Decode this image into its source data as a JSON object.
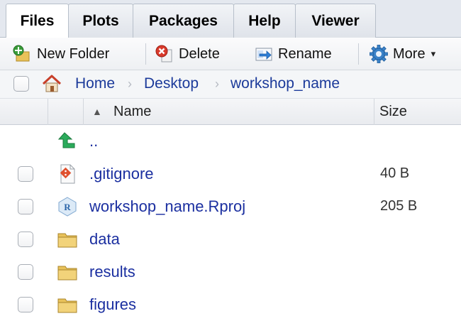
{
  "tabs": [
    {
      "label": "Files",
      "active": true
    },
    {
      "label": "Plots",
      "active": false
    },
    {
      "label": "Packages",
      "active": false
    },
    {
      "label": "Help",
      "active": false
    },
    {
      "label": "Viewer",
      "active": false
    }
  ],
  "toolbar": {
    "new_folder": {
      "label": "New Folder",
      "icon": "new-folder-icon"
    },
    "delete": {
      "label": "Delete",
      "icon": "delete-icon"
    },
    "rename": {
      "label": "Rename",
      "icon": "rename-icon"
    },
    "more": {
      "label": "More",
      "icon": "gear-icon",
      "caret": "▾"
    }
  },
  "breadcrumb": {
    "home_icon": "home-icon",
    "items": [
      "Home",
      "Desktop",
      "workshop_name"
    ],
    "separator": "›"
  },
  "table": {
    "sort_indicator": "▲",
    "columns": {
      "name": "Name",
      "size": "Size"
    },
    "parent_link": "..",
    "rows": [
      {
        "name": ".gitignore",
        "size": "40 B",
        "icon": "git-file-icon"
      },
      {
        "name": "workshop_name.Rproj",
        "size": "205 B",
        "icon": "rproj-file-icon"
      },
      {
        "name": "data",
        "size": "",
        "icon": "folder-icon"
      },
      {
        "name": "results",
        "size": "",
        "icon": "folder-icon"
      },
      {
        "name": "figures",
        "size": "",
        "icon": "folder-icon"
      }
    ]
  },
  "colors": {
    "link": "#1b2fa0",
    "tab_bg": "#e4e8ef",
    "folder": "#e9c25a",
    "up_arrow": "#2bab5b"
  }
}
